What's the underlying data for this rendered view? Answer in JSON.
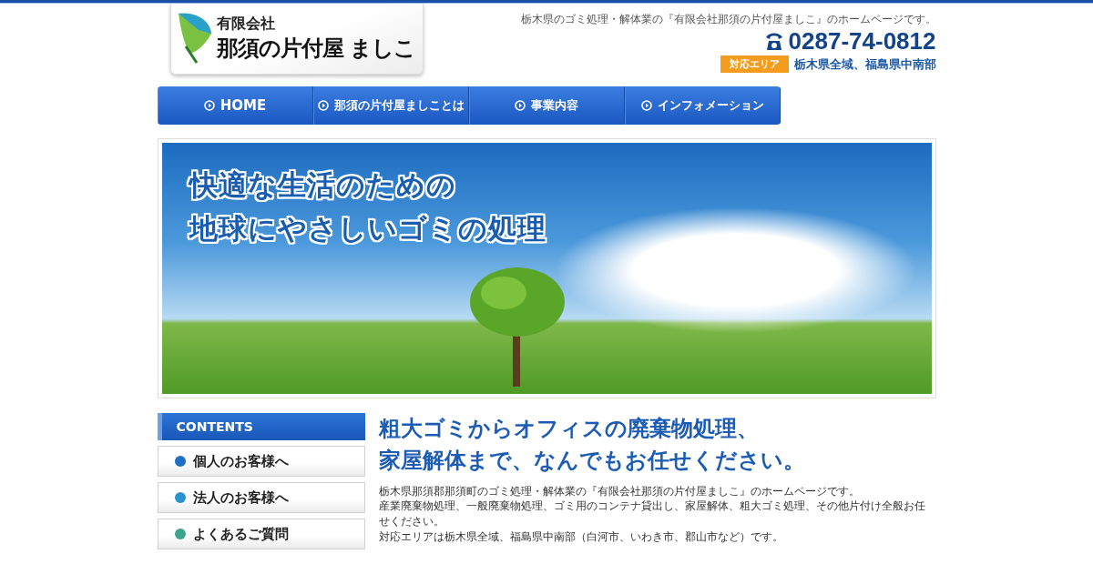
{
  "header": {
    "tagline": "栃木県のゴミ処理・解体業の『有限会社那須の片付屋ましこ』のホームページです。",
    "logo": {
      "company_type": "有限会社",
      "name": "那須の片付屋 ましこ"
    },
    "phone": "0287-74-0812",
    "area_badge": "対応エリア",
    "area_text": "栃木県全域、福島県中南部"
  },
  "nav": [
    {
      "label": "HOME"
    },
    {
      "label": "那須の片付屋ましことは"
    },
    {
      "label": "事業内容"
    },
    {
      "label": "インフォメーション"
    }
  ],
  "hero": {
    "lines": [
      "快適な生活のための",
      "地球にやさしいゴミの処理"
    ]
  },
  "sidebar": {
    "title": "CONTENTS",
    "items": [
      {
        "label": "個人のお客様へ",
        "color": "#1f6fc4"
      },
      {
        "label": "法人のお客様へ",
        "color": "#2a94cf"
      },
      {
        "label": "よくあるご質問",
        "color": "#3aa58a"
      }
    ]
  },
  "main": {
    "heading_lines": [
      "粗大ゴミからオフィスの廃棄物処理、",
      "家屋解体まで、なんでもお任せください。"
    ],
    "paragraphs": [
      "栃木県那須郡那須町のゴミ処理・解体業の『有限会社那須の片付屋ましこ』のホームページです。",
      "産業廃棄物処理、一般廃棄物処理、ゴミ用のコンテナ貸出し、家屋解体、粗大ゴミ処理、その他片付け全般お任せください。",
      "対応エリアは栃木県全域、福島県中南部（白河市、いわき市、郡山市など）です。"
    ]
  }
}
